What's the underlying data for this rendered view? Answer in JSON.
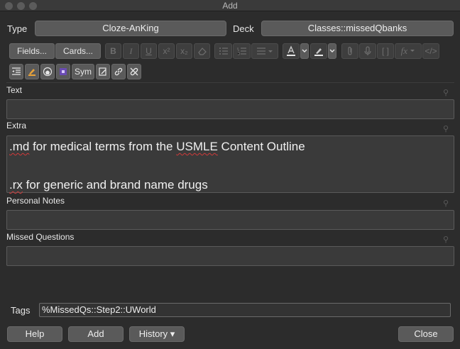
{
  "window": {
    "title": "Add"
  },
  "type": {
    "label": "Type",
    "value": "Cloze-AnKing"
  },
  "deck": {
    "label": "Deck",
    "value": "Classes::missedQbanks"
  },
  "toolbar": {
    "fields_label": "Fields...",
    "cards_label": "Cards...",
    "bold": "B",
    "italic": "I",
    "underline": "U",
    "superscript": "x²",
    "subscript": "x₂",
    "cloze": "[ ]",
    "mathjax": "fx",
    "html": "</>",
    "sym_label": "Sym",
    "text_color_accent": "#e8e8e8",
    "highlight_accent": "#e8e8e8"
  },
  "fields": [
    {
      "label": "Text",
      "lines": []
    },
    {
      "label": "Extra",
      "lines": [
        {
          "prefix": ".md",
          "text": " for medical terms from the ",
          "underlined": "USMLE",
          "suffix": " Content Outline"
        },
        {
          "prefix": ".rx",
          "text": " for generic and brand name drugs",
          "underlined": "",
          "suffix": ""
        }
      ]
    },
    {
      "label": "Personal Notes",
      "lines": []
    },
    {
      "label": "Missed Questions",
      "lines": []
    }
  ],
  "tags": {
    "label": "Tags",
    "value": "%MissedQs::Step2::UWorld"
  },
  "buttons": {
    "help": "Help",
    "add": "Add",
    "history": "History ▾",
    "close": "Close"
  }
}
